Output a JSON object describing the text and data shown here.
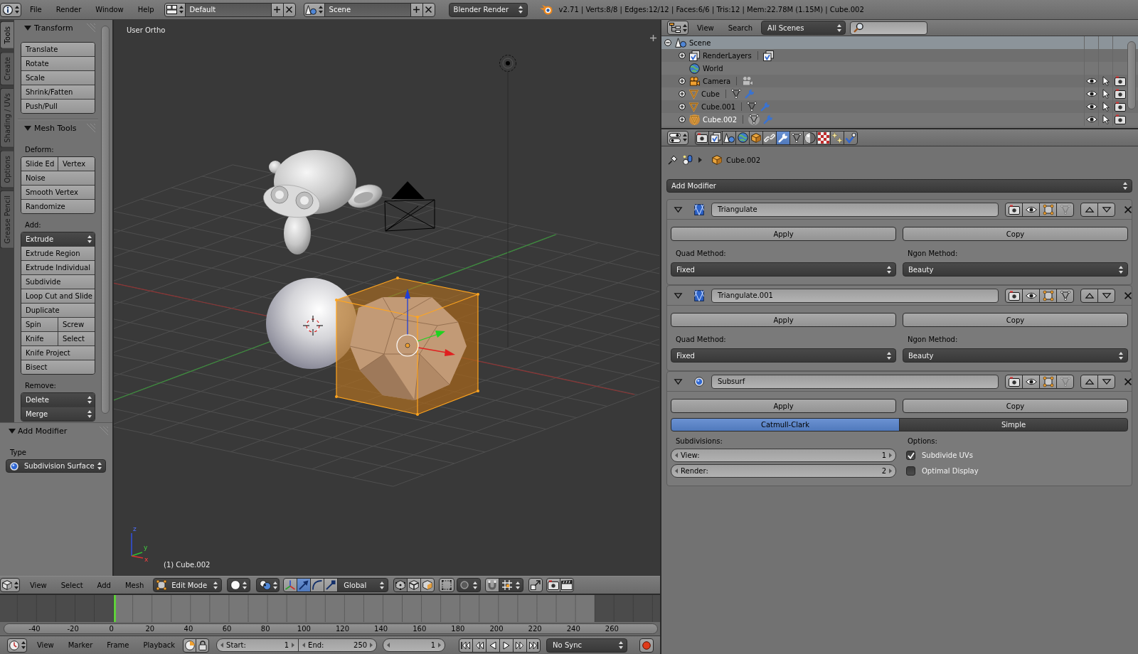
{
  "top_bar": {
    "menus": [
      "File",
      "Render",
      "Window",
      "Help"
    ],
    "screen_layout": "Default",
    "scene": "Scene",
    "render_engine": "Blender Render",
    "stats": "v2.71 | Verts:8/8 | Edges:12/12 | Faces:6/6 | Tris:12 | Mem:22.78M (1.15M) | Cube.002"
  },
  "tool_shelf": {
    "tabs": [
      {
        "label": "Tools",
        "selected": true
      },
      {
        "label": "Create",
        "selected": false
      },
      {
        "label": "Shading / UVs",
        "selected": false
      },
      {
        "label": "Options",
        "selected": false
      },
      {
        "label": "Grease Pencil",
        "selected": false
      }
    ],
    "panels": [
      {
        "title": "Transform",
        "expanded": true,
        "items": [
          {
            "kind": "button",
            "labels": [
              "Translate"
            ]
          },
          {
            "kind": "button",
            "labels": [
              "Rotate"
            ]
          },
          {
            "kind": "button",
            "labels": [
              "Scale"
            ]
          },
          {
            "kind": "button",
            "labels": [
              "Shrink/Fatten"
            ]
          },
          {
            "kind": "button",
            "labels": [
              "Push/Pull"
            ]
          }
        ]
      },
      {
        "title": "Mesh Tools",
        "expanded": true,
        "items": [
          {
            "kind": "label",
            "text": "Deform:"
          },
          {
            "kind": "button",
            "labels": [
              "Slide Ed",
              "Vertex"
            ]
          },
          {
            "kind": "button",
            "labels": [
              "Noise"
            ]
          },
          {
            "kind": "button",
            "labels": [
              "Smooth Vertex"
            ]
          },
          {
            "kind": "button",
            "labels": [
              "Randomize"
            ]
          },
          {
            "kind": "label",
            "text": "Add:"
          },
          {
            "kind": "menu",
            "text": "Extrude"
          },
          {
            "kind": "button",
            "labels": [
              "Extrude Region"
            ]
          },
          {
            "kind": "button",
            "labels": [
              "Extrude Individual"
            ]
          },
          {
            "kind": "button",
            "labels": [
              "Subdivide"
            ]
          },
          {
            "kind": "button",
            "labels": [
              "Loop Cut and Slide"
            ]
          },
          {
            "kind": "button",
            "labels": [
              "Duplicate"
            ]
          },
          {
            "kind": "button",
            "labels": [
              "Spin",
              "Screw"
            ]
          },
          {
            "kind": "button",
            "labels": [
              "Knife",
              "Select"
            ]
          },
          {
            "kind": "button",
            "labels": [
              "Knife Project"
            ]
          },
          {
            "kind": "button",
            "labels": [
              "Bisect"
            ]
          },
          {
            "kind": "label",
            "text": "Remove:"
          },
          {
            "kind": "menu",
            "text": "Delete"
          },
          {
            "kind": "menu",
            "text": "Merge"
          }
        ]
      }
    ],
    "operator_panel": {
      "title": "Add Modifier",
      "expanded": true,
      "field_label": "Type",
      "type": "Subdivision Surface"
    }
  },
  "viewport": {
    "view_name": "User Ortho",
    "object_info": "(1) Cube.002",
    "axis_labels": [
      "z",
      "y",
      "x"
    ]
  },
  "view3d_header": {
    "menus": [
      "View",
      "Select",
      "Add",
      "Mesh"
    ],
    "mode": "Edit Mode",
    "manipulators": [
      {
        "kind": "axes",
        "selected": false
      },
      {
        "kind": "translate",
        "selected": true
      },
      {
        "kind": "rotate",
        "selected": false
      },
      {
        "kind": "scale",
        "selected": false
      }
    ],
    "orientation": "Global",
    "select_modes": [
      {
        "kind": "vertex",
        "selected": true
      },
      {
        "kind": "edge",
        "selected": false
      },
      {
        "kind": "face",
        "selected": false
      }
    ]
  },
  "timeline": {
    "ruler_labels": [
      "-40",
      "-20",
      "0",
      "20",
      "40",
      "60",
      "80",
      "100",
      "120",
      "140",
      "160",
      "180",
      "200",
      "220",
      "240",
      "260"
    ],
    "menus": [
      "View",
      "Marker",
      "Frame",
      "Playback"
    ],
    "start": {
      "label": "Start:",
      "value": "1"
    },
    "end": {
      "label": "End:",
      "value": "250"
    },
    "current_frame": "1",
    "sync": "No Sync"
  },
  "outliner": {
    "menus": [
      "View",
      "Search"
    ],
    "filter": "All Scenes",
    "tree": [
      {
        "name": "Scene",
        "kind": "scene",
        "expandable": true,
        "expanded": true,
        "selected": true,
        "active": false,
        "children": [
          {
            "name": "RenderLayers",
            "kind": "render_layers",
            "expandable": true,
            "expanded": false,
            "selected": false,
            "active": false
          },
          {
            "name": "World",
            "kind": "world",
            "expandable": false,
            "selected": false,
            "active": false
          },
          {
            "name": "Camera",
            "kind": "camera",
            "expandable": true,
            "expanded": false,
            "selected": false,
            "active": false,
            "visible": true,
            "selectable": true,
            "renderable": true
          },
          {
            "name": "Cube",
            "kind": "mesh",
            "expandable": true,
            "expanded": false,
            "selected": false,
            "active": false,
            "visible": true,
            "selectable": true,
            "renderable": true
          },
          {
            "name": "Cube.001",
            "kind": "mesh",
            "expandable": true,
            "expanded": false,
            "selected": false,
            "active": false,
            "visible": true,
            "selectable": true,
            "renderable": true
          },
          {
            "name": "Cube.002",
            "kind": "mesh",
            "expandable": true,
            "expanded": false,
            "selected": false,
            "active": true,
            "visible": true,
            "selectable": true,
            "renderable": true
          }
        ]
      }
    ]
  },
  "properties": {
    "context_tabs": [
      {
        "kind": "render",
        "selected": false
      },
      {
        "kind": "render_layers",
        "selected": false
      },
      {
        "kind": "scene",
        "selected": false
      },
      {
        "kind": "world",
        "selected": false
      },
      {
        "kind": "object",
        "selected": false
      },
      {
        "kind": "constraints",
        "selected": false
      },
      {
        "kind": "modifiers",
        "selected": true
      },
      {
        "kind": "data",
        "selected": false
      },
      {
        "kind": "material",
        "selected": false
      },
      {
        "kind": "texture",
        "selected": false
      },
      {
        "kind": "particles",
        "selected": false
      },
      {
        "kind": "physics",
        "selected": false
      }
    ],
    "breadcrumb": "Cube.002",
    "add_modifier": "Add Modifier",
    "modifiers": [
      {
        "kind": "triangulate",
        "name": "Triangulate",
        "expanded": true,
        "render": true,
        "viewport": true,
        "edit_mode": true,
        "on_cage": false,
        "apply": "Apply",
        "copy": "Copy",
        "quad_method_label": "Quad Method:",
        "quad_method": "Fixed",
        "ngon_method_label": "Ngon Method:",
        "ngon_method": "Beauty"
      },
      {
        "kind": "triangulate",
        "name": "Triangulate.001",
        "expanded": true,
        "render": true,
        "viewport": true,
        "edit_mode": true,
        "on_cage": true,
        "apply": "Apply",
        "copy": "Copy",
        "quad_method_label": "Quad Method:",
        "quad_method": "Fixed",
        "ngon_method_label": "Ngon Method:",
        "ngon_method": "Beauty"
      },
      {
        "kind": "subsurf",
        "name": "Subsurf",
        "expanded": true,
        "render": true,
        "viewport": true,
        "edit_mode": true,
        "on_cage": false,
        "apply": "Apply",
        "copy": "Copy",
        "algorithms": [
          {
            "label": "Catmull-Clark",
            "selected": true
          },
          {
            "label": "Simple",
            "selected": false
          }
        ],
        "subdivisions_label": "Subdivisions:",
        "levels": [
          {
            "label": "View:",
            "value": "1"
          },
          {
            "label": "Render:",
            "value": "2"
          }
        ],
        "options_label": "Options:",
        "options": [
          {
            "label": "Subdivide UVs",
            "checked": true
          },
          {
            "label": "Optimal Display",
            "checked": false
          }
        ]
      }
    ]
  }
}
